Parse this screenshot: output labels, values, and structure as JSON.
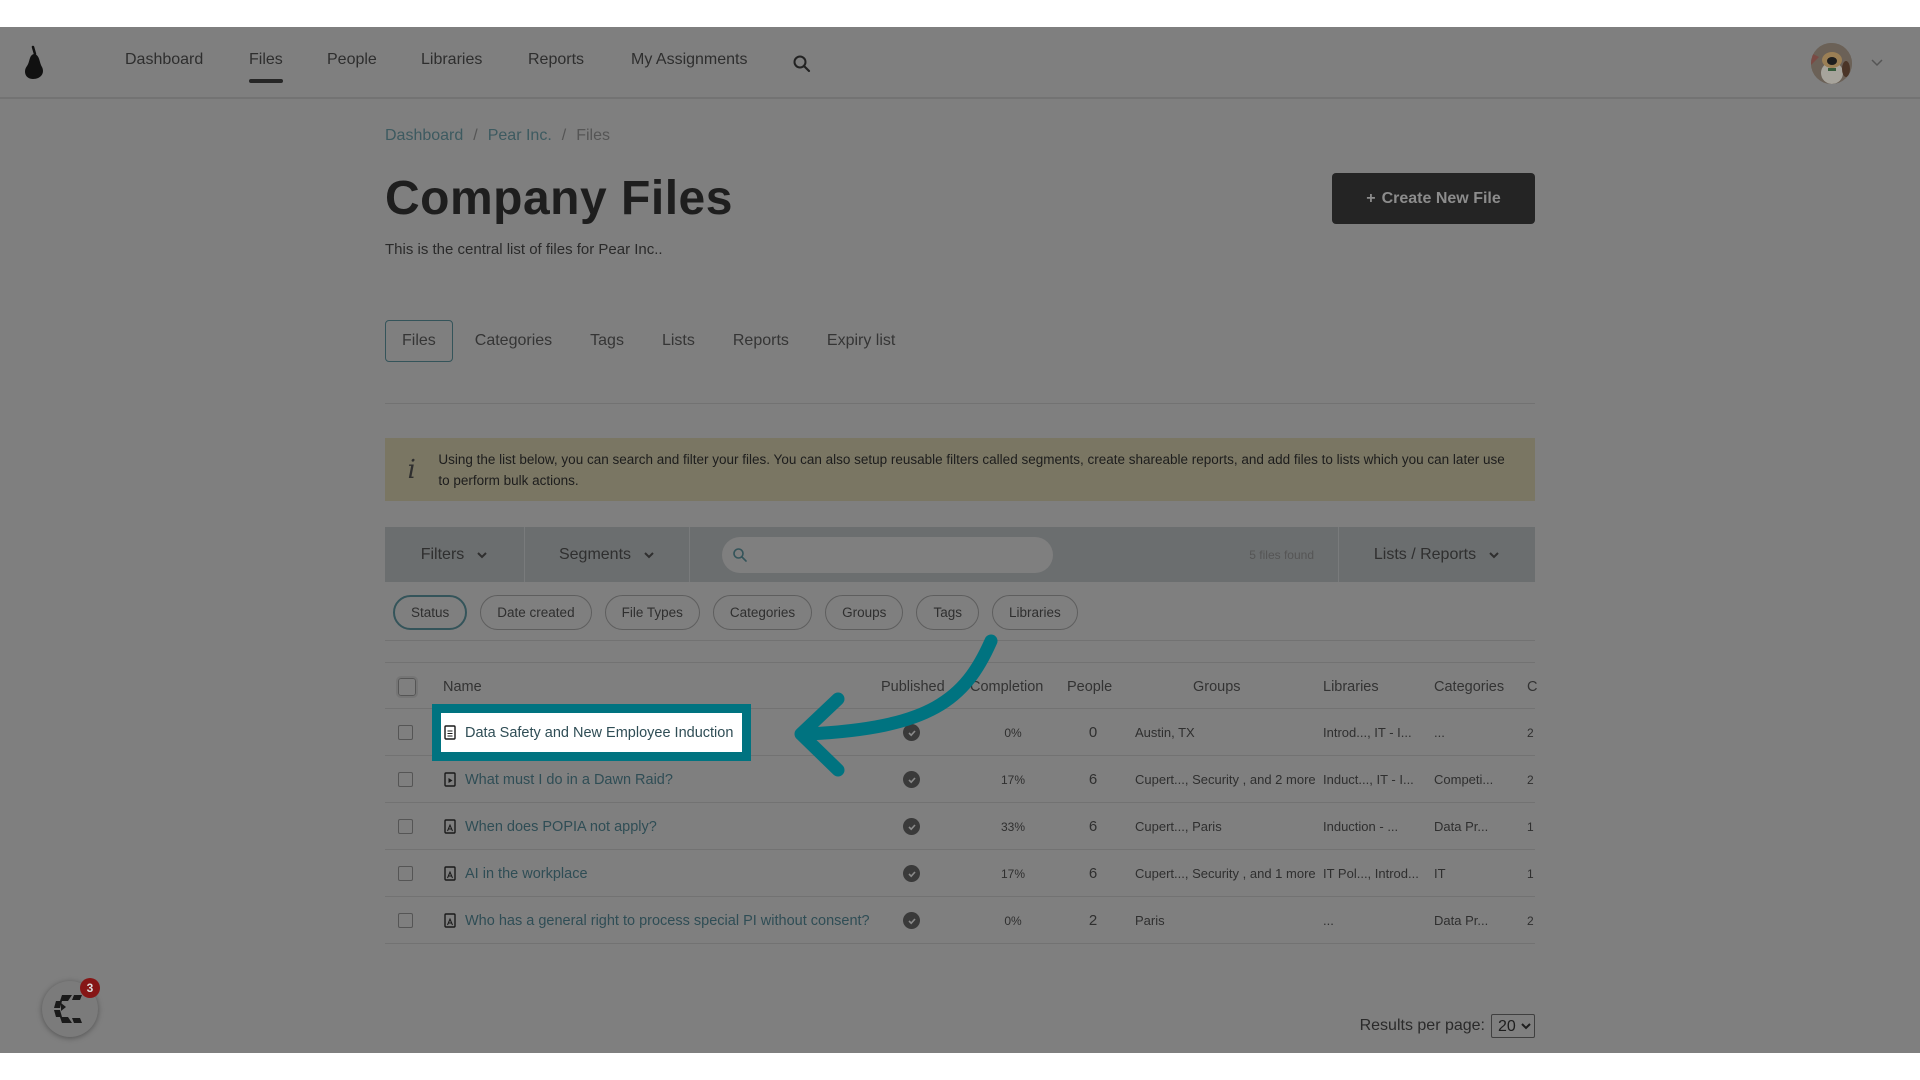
{
  "navbar": {
    "logo": "pear-logo",
    "items": [
      {
        "label": "Dashboard",
        "active": false
      },
      {
        "label": "Files",
        "active": true
      },
      {
        "label": "People",
        "active": false
      },
      {
        "label": "Libraries",
        "active": false
      },
      {
        "label": "Reports",
        "active": false
      },
      {
        "label": "My Assignments",
        "active": false
      }
    ],
    "search_icon": "search-icon",
    "avatar": "user-avatar"
  },
  "breadcrumb": [
    {
      "label": "Dashboard"
    },
    {
      "label": "Pear Inc."
    },
    {
      "label": "Files"
    }
  ],
  "breadcrumb_separator": "/",
  "page": {
    "title": "Company Files",
    "subtitle": "This is the central list of files for Pear Inc..",
    "create_button": {
      "icon": "+",
      "label": "Create New File"
    }
  },
  "tabs": [
    {
      "label": "Files",
      "active": true
    },
    {
      "label": "Categories",
      "active": false
    },
    {
      "label": "Tags",
      "active": false
    },
    {
      "label": "Lists",
      "active": false
    },
    {
      "label": "Reports",
      "active": false
    },
    {
      "label": "Expiry list",
      "active": false
    }
  ],
  "info_banner": {
    "icon": "i",
    "text": "Using the list below, you can search and filter your files. You can also setup reusable filters called segments, create shareable reports, and add files to lists which you can later use to perform bulk actions."
  },
  "toolbar": {
    "filters_label": "Filters",
    "segments_label": "Segments",
    "search_value": "",
    "search_placeholder": "",
    "files_found": "5 files found",
    "lists_reports_label": "Lists / Reports"
  },
  "filter_chips": [
    {
      "label": "Status",
      "active": true
    },
    {
      "label": "Date created",
      "active": false
    },
    {
      "label": "File Types",
      "active": false
    },
    {
      "label": "Categories",
      "active": false
    },
    {
      "label": "Groups",
      "active": false
    },
    {
      "label": "Tags",
      "active": false
    },
    {
      "label": "Libraries",
      "active": false
    }
  ],
  "table": {
    "columns": [
      "Name",
      "Published",
      "Completion",
      "People",
      "Groups",
      "Libraries",
      "Categories",
      "C"
    ],
    "rows": [
      {
        "name": "Data Safety and New Employee Induction",
        "file_icon": "document-icon",
        "published": true,
        "completion": "0%",
        "people": "0",
        "groups": "Austin, TX",
        "libraries": "Introd..., IT - I...",
        "categories": "...",
        "extra": "2",
        "highlighted": true
      },
      {
        "name": "What must I do in a Dawn Raid?",
        "file_icon": "video-file-icon",
        "published": true,
        "completion": "17%",
        "people": "6",
        "groups": "Cupert..., Security , and 2 more",
        "libraries": "Induct..., IT - I...",
        "categories": "Competi...",
        "extra": "2",
        "highlighted": false
      },
      {
        "name": "When does POPIA not apply?",
        "file_icon": "pdf-file-icon",
        "published": true,
        "completion": "33%",
        "people": "6",
        "groups": "Cupert..., Paris",
        "libraries": "Induction - ...",
        "categories": "Data Pr...",
        "extra": "1",
        "highlighted": false
      },
      {
        "name": "AI in the workplace",
        "file_icon": "pdf-file-icon",
        "published": true,
        "completion": "17%",
        "people": "6",
        "groups": "Cupert..., Security , and 1 more",
        "libraries": "IT Pol..., Introd...",
        "categories": "IT",
        "extra": "1",
        "highlighted": false
      },
      {
        "name": "Who has a general right to process special PI without consent?",
        "file_icon": "pdf-file-icon",
        "published": true,
        "completion": "0%",
        "people": "2",
        "groups": "Paris",
        "libraries": "...",
        "categories": "Data Pr...",
        "extra": "2",
        "highlighted": false
      }
    ]
  },
  "pagination": {
    "results_per_page_label": "Results per page:",
    "results_per_page_value": "20"
  },
  "help_widget": {
    "badge_count": "3"
  },
  "colors": {
    "overlay": "#7f7f7f",
    "highlight": "#007380",
    "link": "#2f4d55",
    "badge": "#861616",
    "primary_button": "#242424"
  }
}
